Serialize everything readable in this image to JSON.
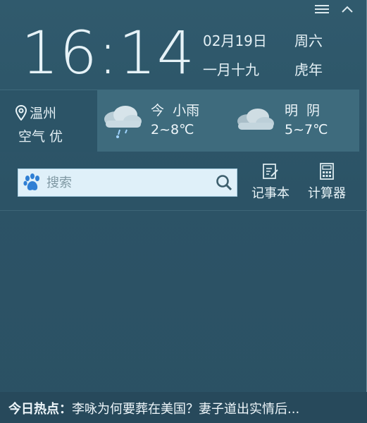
{
  "clock": {
    "time": "16:14",
    "date": "02月19日",
    "weekday": "周六",
    "lunar_date": "一月十九",
    "zodiac_year": "虎年"
  },
  "location": {
    "city": "温州",
    "air_quality": "空气 优"
  },
  "forecast": [
    {
      "day": "今",
      "condition": "小雨",
      "temp_range": "2~8℃",
      "icon": "light-rain-cloud-icon"
    },
    {
      "day": "明",
      "condition": "阴",
      "temp_range": "5~7℃",
      "icon": "overcast-cloud-icon"
    }
  ],
  "search": {
    "placeholder": "搜索"
  },
  "tools": {
    "notepad_label": "记事本",
    "calculator_label": "计算器"
  },
  "news": {
    "title": "今日热点：",
    "headline": "李咏为何要葬在美国？妻子道出实情后..."
  },
  "colors": {
    "panel_bg": "#2c5366",
    "strip_bg": "#3e6b7d",
    "search_bg": "#dff0f9",
    "accent_blue": "#2f7fd4"
  }
}
